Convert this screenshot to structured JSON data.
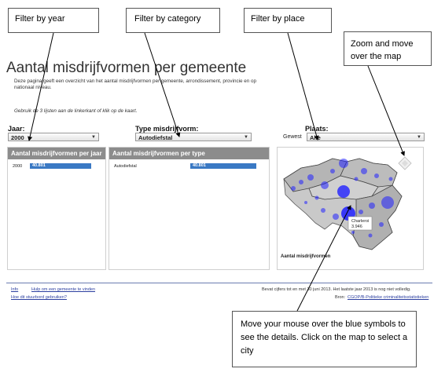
{
  "callouts": {
    "filter_year": "Filter by year",
    "filter_category": "Filter by category",
    "filter_place": "Filter by place",
    "zoom_move": "Zoom and move over the map",
    "mouse_hint": "Move your mouse over the blue symbols to see the details. Click on the map to select a city"
  },
  "page": {
    "title": "Aantal misdrijfvormen per gemeente",
    "intro": "Deze pagina geeft een overzicht van het aantal misdrijfvormen per gemeente, arrondissement, provincie en op nationaal niveau.",
    "hint": "Gebruik de 3 lijsten aan de linkerkant of klik op de kaart."
  },
  "filters": {
    "year_label": "Jaar:",
    "year_value": "2000",
    "category_label": "Type misdrijfvorm:",
    "category_value": "Autodiefstal",
    "place_label": "Plaats:",
    "place_prefix": "Gewest",
    "place_value": "Alle"
  },
  "panels": {
    "year": {
      "header": "Aantal misdrijfvormen per jaar",
      "rows": [
        {
          "label": "2000",
          "value": "40.801",
          "fraction": 1.0
        }
      ]
    },
    "type": {
      "header": "Aantal misdrijfvormen per type",
      "rows": [
        {
          "label": "Autodiefstal",
          "value": "40.801",
          "fraction": 1.0
        }
      ]
    },
    "map": {
      "caption": "Aantal misdrijfvormen",
      "tooltip_city": "Charleroi",
      "tooltip_value": "3.946"
    }
  },
  "footer": {
    "link1": "Info",
    "link2": "Hulp om een gemeente te vinden",
    "link3": "Hoe dit stuurbord gebruiken?",
    "note": "Bevat cijfers tot en met 30 juni 2013. Het laatste jaar 2013 is nog niet volledig.",
    "source_label": "Bron:",
    "source_link": "CGOP/B-Politieke criminaliteitsstatistieken"
  },
  "colors": {
    "header_gray": "#8c8c8c",
    "bar_blue": "#3a79c4",
    "bubble_blue": "#2020ff",
    "link_blue": "#2c3fa0"
  }
}
